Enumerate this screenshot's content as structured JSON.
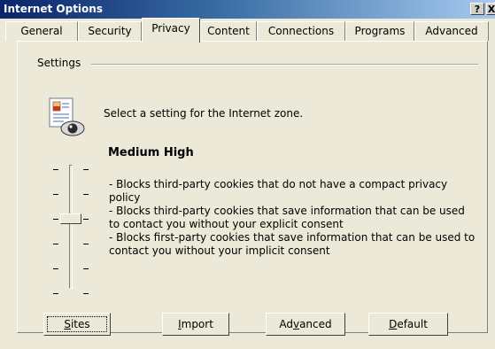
{
  "window": {
    "title": "Internet Options",
    "help_glyph": "?",
    "close_glyph": "X"
  },
  "tabs": [
    {
      "label": "General"
    },
    {
      "label": "Security"
    },
    {
      "label": "Privacy",
      "active": true
    },
    {
      "label": "Content"
    },
    {
      "label": "Connections"
    },
    {
      "label": "Programs"
    },
    {
      "label": "Advanced"
    }
  ],
  "settings": {
    "group_label": "Settings",
    "zone_text": "Select a setting for the Internet zone.",
    "level": "Medium High",
    "slider_level_index": 2,
    "slider_levels_total": 6,
    "description": "- Blocks third-party cookies that do not have a compact privacy policy\n- Blocks third-party cookies that save information that can be used to contact you without your explicit consent\n- Blocks first-party cookies that save information that can be used to contact you without your implicit consent"
  },
  "buttons": {
    "sites": {
      "pre": "",
      "accel": "S",
      "post": "ites"
    },
    "import": {
      "pre": "",
      "accel": "I",
      "post": "mport"
    },
    "advanced": {
      "pre": "Ad",
      "accel": "v",
      "post": "anced"
    },
    "default": {
      "pre": "",
      "accel": "D",
      "post": "efault"
    }
  },
  "icons": {
    "privacy": "privacy-document-eye-icon"
  }
}
